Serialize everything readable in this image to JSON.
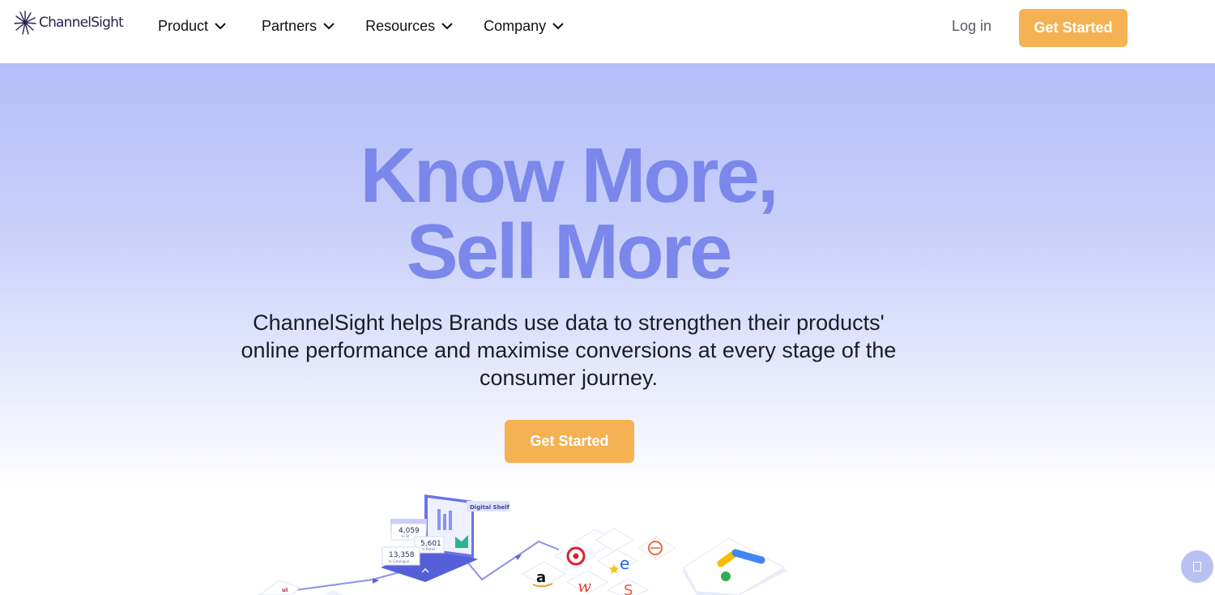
{
  "brand": {
    "name": "ChannelSight"
  },
  "nav": {
    "items": [
      {
        "label": "Product"
      },
      {
        "label": "Partners"
      },
      {
        "label": "Resources"
      },
      {
        "label": "Company"
      }
    ],
    "login_label": "Log in",
    "cta_label": "Get Started"
  },
  "hero": {
    "title_line1": "Know More,",
    "title_line2": "Sell More",
    "subtitle": "ChannelSight helps Brands use data to strengthen their products' online performance and maximise conversions at every stage of the consumer journey.",
    "cta_label": "Get Started"
  },
  "illustration": {
    "badge": "Digital Shelf",
    "stat1_value": "4,059",
    "stat1_label": "In St",
    "stat2_value": "5,601",
    "stat2_label": "In Retail",
    "stat3_value": "13,358",
    "stat3_label": "In Catalogue"
  },
  "colors": {
    "accent": "#f5b253",
    "headline": "#7c87eb",
    "hero_top": "#b4bff8"
  }
}
